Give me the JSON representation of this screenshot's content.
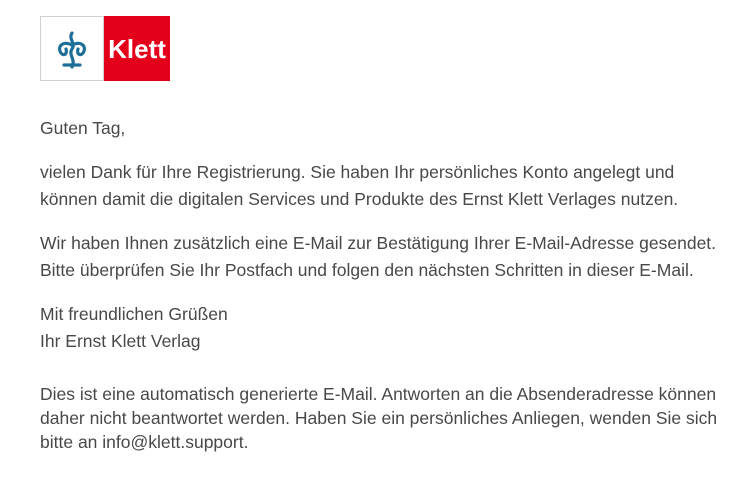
{
  "brand": {
    "wordmark": "Klett",
    "emblem_icon": "klett-tree-icon",
    "colors": {
      "brand_red": "#e4001b",
      "emblem_blue": "#1d6f9a",
      "text": "#484848"
    }
  },
  "email": {
    "greeting": "Guten Tag,",
    "paragraph1": "vielen Dank für Ihre Registrierung. Sie haben Ihr persönliches Konto angelegt und können damit die digitalen Services und Produkte des Ernst Klett Verlages nutzen.",
    "paragraph2": "Wir haben Ihnen zusätzlich eine E-Mail zur Bestätigung Ihrer E-Mail-Adresse gesendet. Bitte überprüfen Sie Ihr Postfach und folgen den nächsten Schritten in dieser E-Mail.",
    "closing": "Mit freundlichen Grüßen",
    "signature": "Ihr Ernst Klett Verlag",
    "footer_text": "Dies ist eine automatisch generierte E-Mail. Antworten an die Absenderadresse können daher nicht beantwortet werden. Haben Sie ein persönliches Anliegen, wenden Sie sich bitte an ",
    "support_email": "info@klett.support",
    "footer_end": "."
  }
}
